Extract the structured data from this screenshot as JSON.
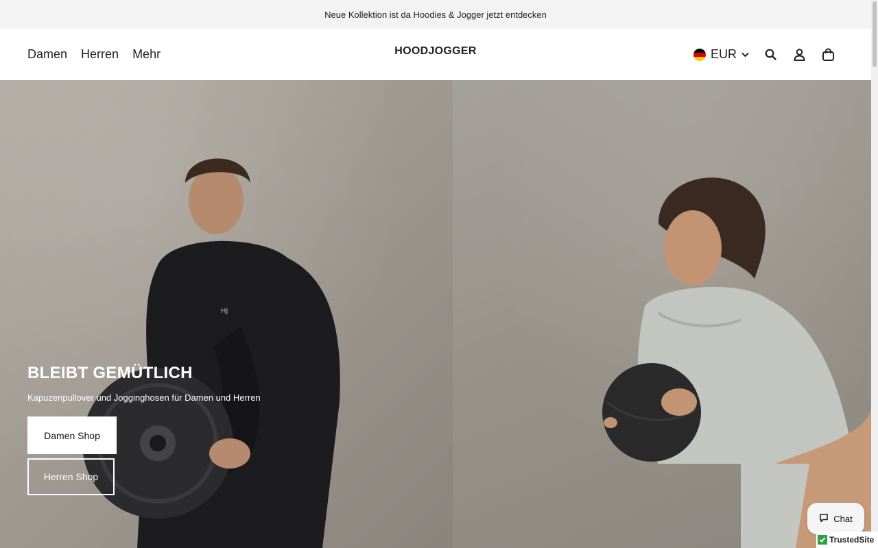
{
  "announcement": {
    "text": "Neue Kollektion ist da Hoodies & Jogger jetzt entdecken"
  },
  "header": {
    "nav": [
      {
        "label": "Damen"
      },
      {
        "label": "Herren"
      },
      {
        "label": "Mehr"
      }
    ],
    "logo": "HOODJOGGER",
    "currency": {
      "label": "EUR",
      "flag": "germany-flag",
      "icon": "chevron-down-icon"
    },
    "icons": [
      "search-icon",
      "account-icon",
      "cart-icon"
    ]
  },
  "hero": {
    "title": "BLEIBT GEMÜTLICH",
    "subtitle": "Kapuzenpullover und Jogginghosen für Damen und Herren",
    "primary_button": "Damen Shop",
    "secondary_button": "Herren Shop",
    "images": [
      "man-in-black-hoodie-holding-weight-plate",
      "woman-in-grey-hoodie-holding-medicine-ball"
    ]
  },
  "chat": {
    "label": "Chat",
    "icon": "chat-bubble-icon"
  },
  "trusted_badge": {
    "label": "TrustedSite"
  },
  "colors": {
    "announcement_bg": "#f3f3f3",
    "text": "#1a1a1a",
    "hero_button_bg": "#ffffff",
    "trust_green": "#2e9e3e"
  }
}
